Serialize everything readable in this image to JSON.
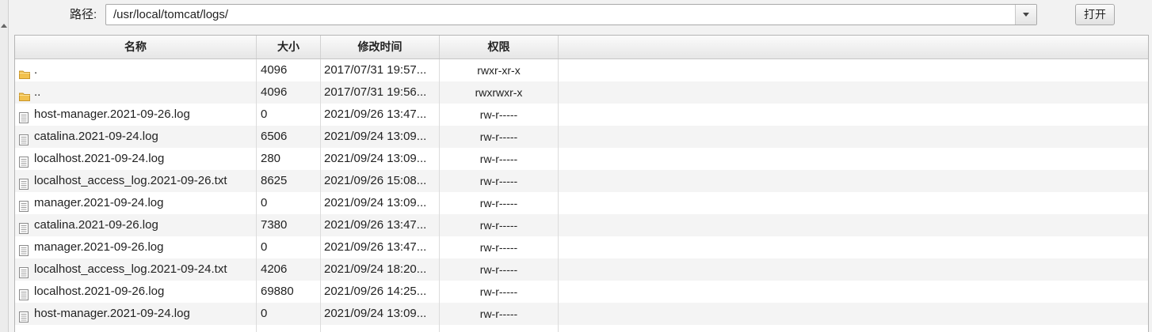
{
  "toolbar": {
    "path_label": "路径:",
    "path_value": "/usr/local/tomcat/logs/",
    "open_label": "打开"
  },
  "table": {
    "columns": [
      "名称",
      "大小",
      "修改时间",
      "权限"
    ],
    "rows": [
      {
        "icon": "folder-icon",
        "name": ".",
        "size": "4096",
        "modified": "2017/07/31 19:57...",
        "perm": "rwxr-xr-x"
      },
      {
        "icon": "folder-icon",
        "name": "..",
        "size": "4096",
        "modified": "2017/07/31 19:56...",
        "perm": "rwxrwxr-x"
      },
      {
        "icon": "file-icon",
        "name": "host-manager.2021-09-26.log",
        "size": "0",
        "modified": "2021/09/26 13:47...",
        "perm": "rw-r-----"
      },
      {
        "icon": "file-icon",
        "name": "catalina.2021-09-24.log",
        "size": "6506",
        "modified": "2021/09/24 13:09...",
        "perm": "rw-r-----"
      },
      {
        "icon": "file-icon",
        "name": "localhost.2021-09-24.log",
        "size": "280",
        "modified": "2021/09/24 13:09...",
        "perm": "rw-r-----"
      },
      {
        "icon": "file-icon",
        "name": "localhost_access_log.2021-09-26.txt",
        "size": "8625",
        "modified": "2021/09/26 15:08...",
        "perm": "rw-r-----"
      },
      {
        "icon": "file-icon",
        "name": "manager.2021-09-24.log",
        "size": "0",
        "modified": "2021/09/24 13:09...",
        "perm": "rw-r-----"
      },
      {
        "icon": "file-icon",
        "name": "catalina.2021-09-26.log",
        "size": "7380",
        "modified": "2021/09/26 13:47...",
        "perm": "rw-r-----"
      },
      {
        "icon": "file-icon",
        "name": "manager.2021-09-26.log",
        "size": "0",
        "modified": "2021/09/26 13:47...",
        "perm": "rw-r-----"
      },
      {
        "icon": "file-icon",
        "name": "localhost_access_log.2021-09-24.txt",
        "size": "4206",
        "modified": "2021/09/24 18:20...",
        "perm": "rw-r-----"
      },
      {
        "icon": "file-icon",
        "name": "localhost.2021-09-26.log",
        "size": "69880",
        "modified": "2021/09/26 14:25...",
        "perm": "rw-r-----"
      },
      {
        "icon": "file-icon",
        "name": "host-manager.2021-09-24.log",
        "size": "0",
        "modified": "2021/09/24 13:09...",
        "perm": "rw-r-----"
      },
      {
        "icon": "",
        "name": "",
        "size": "",
        "modified": "",
        "perm": ""
      }
    ]
  },
  "colors": {
    "folder": "#f2c14e",
    "row_alt": "#f4f4f4",
    "header_bg": "#e6e6e6"
  }
}
